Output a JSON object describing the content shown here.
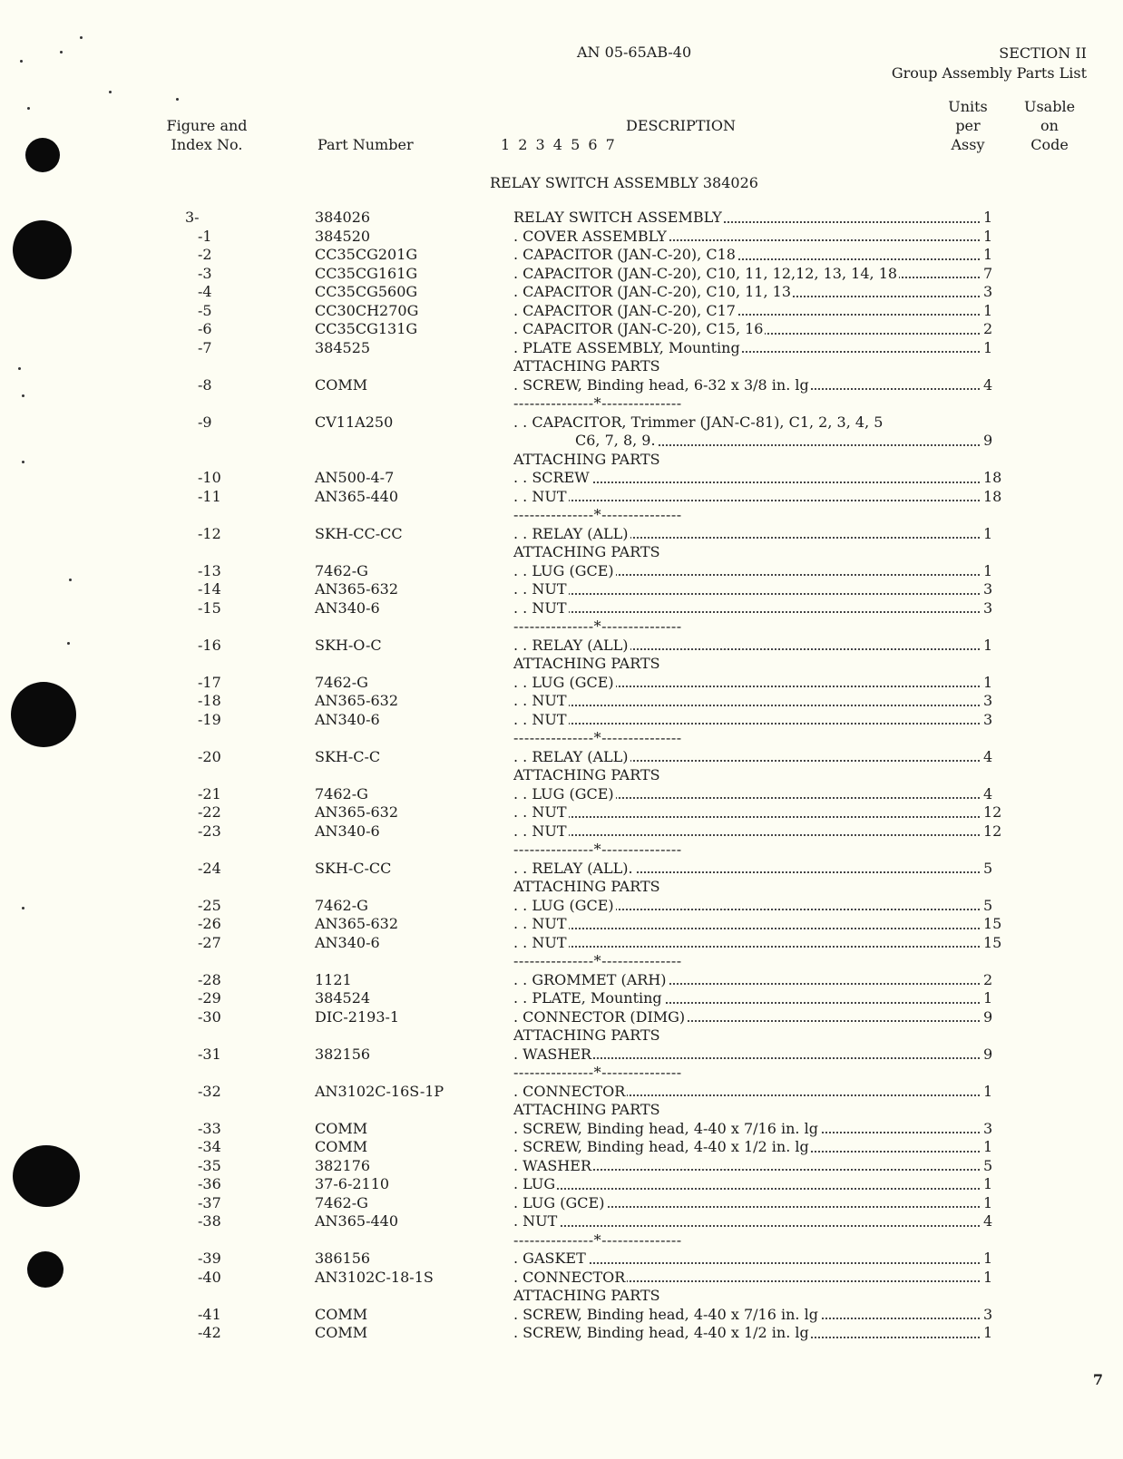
{
  "header": {
    "doc_number": "AN 05-65AB-40",
    "section": "SECTION II",
    "section_title": "Group Assembly Parts List"
  },
  "columns": {
    "figure_index": [
      "Figure and",
      "Index No."
    ],
    "part_number": "Part Number",
    "description": "DESCRIPTION",
    "indent_levels": "1 2 3 4 5 6 7",
    "units": [
      "Units",
      "per",
      "Assy"
    ],
    "usable": [
      "Usable",
      "on",
      "Code"
    ]
  },
  "assembly_title": "RELAY SWITCH ASSEMBLY 384026",
  "rows": [
    {
      "type": "item",
      "index": "3-",
      "part": "384026",
      "desc": "RELAY SWITCH ASSEMBLY",
      "qty": "1"
    },
    {
      "type": "item",
      "index": "-1",
      "part": "384520",
      "desc": ". COVER ASSEMBLY",
      "qty": "1"
    },
    {
      "type": "item",
      "index": "-2",
      "part": "CC35CG201G",
      "desc": ". CAPACITOR (JAN-C-20), C18",
      "qty": "1"
    },
    {
      "type": "item",
      "index": "-3",
      "part": "CC35CG161G",
      "desc": ". CAPACITOR (JAN-C-20), C10, 11, 12,12, 13, 14, 18",
      "qty": "7"
    },
    {
      "type": "item",
      "index": "-4",
      "part": "CC35CG560G",
      "desc": ". CAPACITOR (JAN-C-20), C10, 11, 13",
      "qty": "3"
    },
    {
      "type": "item",
      "index": "-5",
      "part": "CC30CH270G",
      "desc": ". CAPACITOR (JAN-C-20), C17",
      "qty": "1"
    },
    {
      "type": "item",
      "index": "-6",
      "part": "CC35CG131G",
      "desc": ". CAPACITOR (JAN-C-20), C15, 16",
      "qty": "2"
    },
    {
      "type": "item",
      "index": "-7",
      "part": "384525",
      "desc": ". PLATE ASSEMBLY, Mounting",
      "qty": "1"
    },
    {
      "type": "label",
      "text": "ATTACHING PARTS"
    },
    {
      "type": "item",
      "index": "-8",
      "part": "COMM",
      "desc": ". SCREW, Binding head, 6-32 x 3/8 in. lg",
      "qty": "4"
    },
    {
      "type": "sep",
      "text": "---------------*---------------"
    },
    {
      "type": "item",
      "index": "-9",
      "part": "CV11A250",
      "desc": ". . CAPACITOR, Trimmer (JAN-C-81), C1, 2, 3, 4, 5",
      "qty": "",
      "noleader": true
    },
    {
      "type": "cont",
      "desc": "C6, 7, 8, 9.",
      "qty": "9"
    },
    {
      "type": "label",
      "text": "ATTACHING PARTS"
    },
    {
      "type": "item",
      "index": "-10",
      "part": "AN500-4-7",
      "desc": ". . SCREW",
      "qty": "18"
    },
    {
      "type": "item",
      "index": "-11",
      "part": "AN365-440",
      "desc": ". . NUT",
      "qty": "18"
    },
    {
      "type": "sep",
      "text": "---------------*---------------"
    },
    {
      "type": "item",
      "index": "-12",
      "part": "SKH-CC-CC",
      "desc": ". . RELAY (ALL)",
      "qty": "1"
    },
    {
      "type": "label",
      "text": "ATTACHING PARTS"
    },
    {
      "type": "item",
      "index": "-13",
      "part": "7462-G",
      "desc": ". . LUG (GCE)",
      "qty": "1"
    },
    {
      "type": "item",
      "index": "-14",
      "part": "AN365-632",
      "desc": ". . NUT",
      "qty": "3"
    },
    {
      "type": "item",
      "index": "-15",
      "part": "AN340-6",
      "desc": ". . NUT",
      "qty": "3"
    },
    {
      "type": "sep",
      "text": "---------------*---------------"
    },
    {
      "type": "item",
      "index": "-16",
      "part": "SKH-O-C",
      "desc": ". . RELAY (ALL)",
      "qty": "1"
    },
    {
      "type": "label",
      "text": "ATTACHING PARTS"
    },
    {
      "type": "item",
      "index": "-17",
      "part": "7462-G",
      "desc": ". . LUG (GCE)",
      "qty": "1"
    },
    {
      "type": "item",
      "index": "-18",
      "part": "AN365-632",
      "desc": ". . NUT",
      "qty": "3"
    },
    {
      "type": "item",
      "index": "-19",
      "part": "AN340-6",
      "desc": ". . NUT",
      "qty": "3"
    },
    {
      "type": "sep",
      "text": "---------------*---------------"
    },
    {
      "type": "item",
      "index": "-20",
      "part": "SKH-C-C",
      "desc": ". . RELAY (ALL)",
      "qty": "4"
    },
    {
      "type": "label",
      "text": "ATTACHING PARTS"
    },
    {
      "type": "item",
      "index": "-21",
      "part": "7462-G",
      "desc": ". . LUG (GCE)",
      "qty": "4"
    },
    {
      "type": "item",
      "index": "-22",
      "part": "AN365-632",
      "desc": ". . NUT",
      "qty": "12"
    },
    {
      "type": "item",
      "index": "-23",
      "part": "AN340-6",
      "desc": ". . NUT",
      "qty": "12"
    },
    {
      "type": "sep",
      "text": "---------------*---------------"
    },
    {
      "type": "item",
      "index": "-24",
      "part": "SKH-C-CC",
      "desc": ". . RELAY (ALL).",
      "qty": "5"
    },
    {
      "type": "label",
      "text": "ATTACHING PARTS"
    },
    {
      "type": "item",
      "index": "-25",
      "part": "7462-G",
      "desc": ". . LUG (GCE)",
      "qty": "5"
    },
    {
      "type": "item",
      "index": "-26",
      "part": "AN365-632",
      "desc": ". . NUT",
      "qty": "15"
    },
    {
      "type": "item",
      "index": "-27",
      "part": "AN340-6",
      "desc": ". . NUT",
      "qty": "15"
    },
    {
      "type": "sep",
      "text": "---------------*---------------"
    },
    {
      "type": "item",
      "index": "-28",
      "part": "1121",
      "desc": ". . GROMMET (ARH)",
      "qty": "2"
    },
    {
      "type": "item",
      "index": "-29",
      "part": "384524",
      "desc": ". . PLATE, Mounting",
      "qty": "1"
    },
    {
      "type": "item",
      "index": "-30",
      "part": "DIC-2193-1",
      "desc": ". CONNECTOR (DIMG)",
      "qty": "9"
    },
    {
      "type": "label",
      "text": "ATTACHING PARTS"
    },
    {
      "type": "item",
      "index": "-31",
      "part": "382156",
      "desc": ". WASHER",
      "qty": "9"
    },
    {
      "type": "sep",
      "text": "---------------*---------------"
    },
    {
      "type": "item",
      "index": "-32",
      "part": "AN3102C-16S-1P",
      "desc": ". CONNECTOR",
      "qty": "1"
    },
    {
      "type": "label",
      "text": "ATTACHING PARTS"
    },
    {
      "type": "item",
      "index": "-33",
      "part": "COMM",
      "desc": ". SCREW, Binding head, 4-40 x 7/16 in. lg",
      "qty": "3"
    },
    {
      "type": "item",
      "index": "-34",
      "part": "COMM",
      "desc": ". SCREW, Binding head, 4-40 x 1/2 in. lg",
      "qty": "1"
    },
    {
      "type": "item",
      "index": "-35",
      "part": "382176",
      "desc": ". WASHER",
      "qty": "5"
    },
    {
      "type": "item",
      "index": "-36",
      "part": "37-6-2110",
      "desc": ". LUG",
      "qty": "1"
    },
    {
      "type": "item",
      "index": "-37",
      "part": "7462-G",
      "desc": ". LUG (GCE)",
      "qty": "1"
    },
    {
      "type": "item",
      "index": "-38",
      "part": "AN365-440",
      "desc": ". NUT",
      "qty": "4"
    },
    {
      "type": "sep",
      "text": "---------------*---------------"
    },
    {
      "type": "item",
      "index": "-39",
      "part": "386156",
      "desc": ". GASKET",
      "qty": "1"
    },
    {
      "type": "item",
      "index": "-40",
      "part": "AN3102C-18-1S",
      "desc": ". CONNECTOR",
      "qty": "1"
    },
    {
      "type": "label",
      "text": "ATTACHING PARTS"
    },
    {
      "type": "item",
      "index": "-41",
      "part": "COMM",
      "desc": ". SCREW, Binding head, 4-40 x 7/16 in. lg",
      "qty": "3"
    },
    {
      "type": "item",
      "index": "-42",
      "part": "COMM",
      "desc": ". SCREW, Binding head, 4-40 x 1/2 in. lg",
      "qty": "1"
    }
  ],
  "page_number": "7"
}
